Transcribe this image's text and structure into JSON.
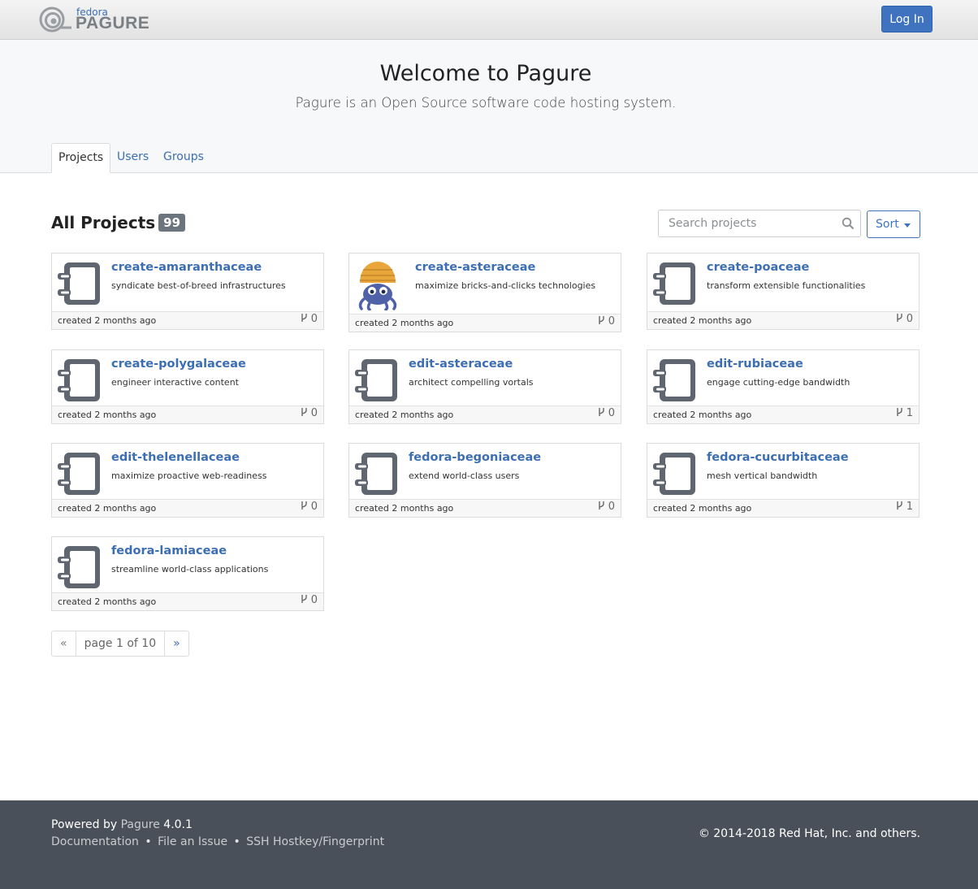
{
  "navbar": {
    "logo_top": "fedora",
    "logo_main": "PAGURE",
    "login_label": "Log In"
  },
  "hero": {
    "title": "Welcome to Pagure",
    "tagline": "Pagure is an Open Source software code hosting system."
  },
  "tabs": [
    "Projects",
    "Users",
    "Groups"
  ],
  "projects_header": {
    "title": "All Projects",
    "count": "99",
    "search_placeholder": "Search projects",
    "sort_label": "Sort"
  },
  "projects": [
    {
      "name": "create-amaranthaceae",
      "description": "syndicate best-of-breed infrastructures",
      "created": "created 2 months ago",
      "forks": "0",
      "icon": "repo-icon"
    },
    {
      "name": "create-asteraceae",
      "description": "maximize bricks-and-clicks technologies",
      "created": "created 2 months ago",
      "forks": "0",
      "icon": "hermit-crab-avatar"
    },
    {
      "name": "create-poaceae",
      "description": "transform extensible functionalities",
      "created": "created 2 months ago",
      "forks": "0",
      "icon": "repo-icon"
    },
    {
      "name": "create-polygalaceae",
      "description": "engineer interactive content",
      "created": "created 2 months ago",
      "forks": "0",
      "icon": "repo-icon"
    },
    {
      "name": "edit-asteraceae",
      "description": "architect compelling vortals",
      "created": "created 2 months ago",
      "forks": "0",
      "icon": "repo-icon"
    },
    {
      "name": "edit-rubiaceae",
      "description": "engage cutting-edge bandwidth",
      "created": "created 2 months ago",
      "forks": "1",
      "icon": "repo-icon"
    },
    {
      "name": "edit-thelenellaceae",
      "description": "maximize proactive web-readiness",
      "created": "created 2 months ago",
      "forks": "0",
      "icon": "repo-icon"
    },
    {
      "name": "fedora-begoniaceae",
      "description": "extend world-class users",
      "created": "created 2 months ago",
      "forks": "0",
      "icon": "repo-icon"
    },
    {
      "name": "fedora-cucurbitaceae",
      "description": "mesh vertical bandwidth",
      "created": "created 2 months ago",
      "forks": "1",
      "icon": "repo-icon"
    },
    {
      "name": "fedora-lamiaceae",
      "description": "streamline world-class applications",
      "created": "created 2 months ago",
      "forks": "0",
      "icon": "repo-icon"
    }
  ],
  "pagination": {
    "prev": "«",
    "label": "page 1 of 10",
    "next": "»"
  },
  "footer": {
    "powered_prefix": "Powered by",
    "powered_link": "Pagure",
    "version": "4.0.1",
    "links": [
      "Documentation",
      "File an Issue",
      "SSH Hostkey/Fingerprint"
    ],
    "separator": "•",
    "copyright": "© 2014-2018 Red Hat, Inc. and others."
  }
}
